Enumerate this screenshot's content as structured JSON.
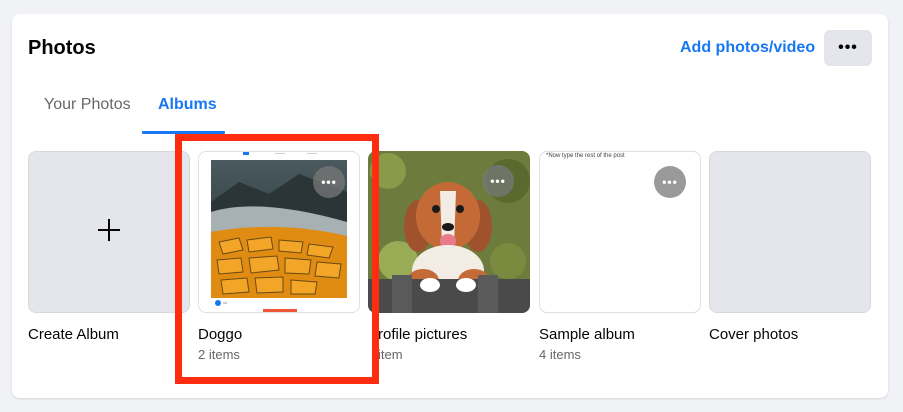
{
  "header": {
    "title": "Photos",
    "add_label": "Add photos/video",
    "more_label": "•••"
  },
  "tabs": [
    {
      "label": "Your Photos",
      "active": false
    },
    {
      "label": "Albums",
      "active": true
    }
  ],
  "albums": [
    {
      "name": "Create Album",
      "count": "",
      "icon": "plus-icon"
    },
    {
      "name": "Doggo",
      "count": "2 items"
    },
    {
      "name": "rofile pictures",
      "count": "item"
    },
    {
      "name": "Sample album",
      "count": "4 items",
      "thumb_text": "*Now type the rest of the post"
    },
    {
      "name": "Cover photos",
      "count": ""
    }
  ],
  "option_label": "•••",
  "colors": {
    "accent": "#1877f2",
    "highlight": "#ff2d10",
    "background": "#f0f2f5"
  }
}
